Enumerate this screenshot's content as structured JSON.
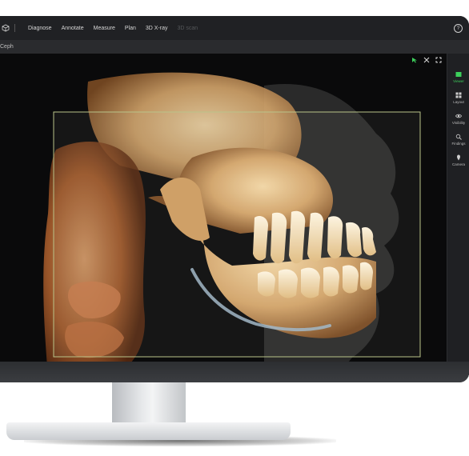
{
  "toolbar": {
    "menu": [
      {
        "label": "Diagnose",
        "disabled": false
      },
      {
        "label": "Annotate",
        "disabled": false
      },
      {
        "label": "Measure",
        "disabled": false
      },
      {
        "label": "Plan",
        "disabled": false
      },
      {
        "label": "3D X-ray",
        "disabled": false
      },
      {
        "label": "3D scan",
        "disabled": true
      }
    ],
    "help_label": "?"
  },
  "tabbar": {
    "active_tab": "Ceph"
  },
  "sidebar": {
    "items": [
      {
        "label": "Viewer",
        "icon": "viewer-icon",
        "active": true
      },
      {
        "label": "Layout",
        "icon": "layout-icon",
        "active": false
      },
      {
        "label": "Visibility",
        "icon": "eye-icon",
        "active": false
      },
      {
        "label": "Findings",
        "icon": "findings-icon",
        "active": false
      },
      {
        "label": "Camera",
        "icon": "camera-icon",
        "active": false
      }
    ],
    "collapse_glyph": "‹"
  },
  "colors": {
    "accent": "#3ccf5b",
    "bone": "#d9b079",
    "soft_tissue": "#a85a2a",
    "crop_box": "#b9c48a",
    "nerve_canal": "#9fb6c8"
  }
}
